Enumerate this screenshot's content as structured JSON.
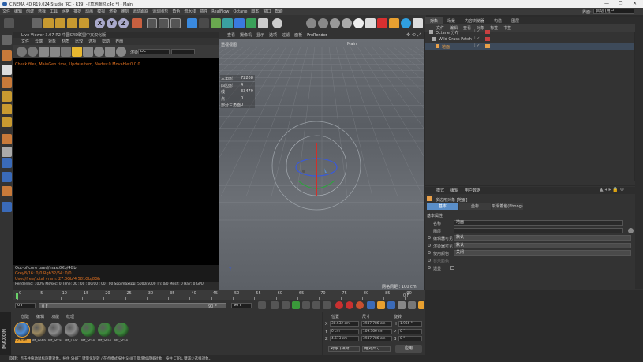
{
  "app": {
    "title": "CINEMA 4D R19.024 Studio (RC - R19) - [草地面积.c4d *] - Main",
    "layout_label": "界面:",
    "layout_value": "启动 (用户)"
  },
  "menu": [
    "文件",
    "编辑",
    "创建",
    "选择",
    "工具",
    "网格",
    "捕捉",
    "动画",
    "模拟",
    "渲染",
    "雕刻",
    "运动跟踪",
    "运动图形",
    "角色",
    "流水线",
    "插件",
    "RealFlow",
    "Octane",
    "脚本",
    "窗口",
    "帮助"
  ],
  "live_viewer": {
    "title": "Live Viewer 3.07-R2 中国C4D联盟中文汉化版",
    "menu": [
      "文件",
      "云端",
      "对象",
      "材质",
      "比较",
      "选项",
      "帮助",
      "界面"
    ],
    "mode_value": "DL",
    "status_line": "Check files, MainGen time, UpdateItem, Nodes:0 Movable:0  0.0",
    "info_lines": [
      "Out-of-core used/max:0Kb/4Gb",
      "Grey8/16: 0/0      Rgb32/64: 0/0",
      "Used/free/total vram: 27.0Gb/4.581Gb/8Gb"
    ],
    "render_status": "Rendering: 100%   Ms/sec: 0   Time: 00 : 00 : 00/00 : 00 : 00   Spp/maxspp: 5000/5000   Tri: 0/0   Mesh: 0   Hair: 0   GPU:"
  },
  "viewport": {
    "menu": [
      "查看",
      "摄像机",
      "显示",
      "选项",
      "过滤",
      "面板",
      "ProRender"
    ],
    "camera_label": "透视视图",
    "camera_name": "Main",
    "stats": [
      {
        "k": "三角形",
        "v": "72208"
      },
      {
        "k": "四边形",
        "v": "4"
      },
      {
        "k": "线",
        "v": "33479"
      },
      {
        "k": "点",
        "v": "0"
      },
      {
        "k": "部分三角面",
        "v": "0"
      }
    ],
    "grid_label": "网格间距 : 100 cm",
    "axis_glyph": "Y"
  },
  "objects": {
    "tabs": [
      "对象",
      "场景",
      "内容浏览器",
      "构造",
      "图层"
    ],
    "menu": [
      "文件",
      "编辑",
      "查看",
      "对象",
      "标签",
      "书签"
    ],
    "items": [
      {
        "name": "Octane 分布",
        "color": "#aaaaaa"
      },
      {
        "name": "Wild Grass Patch",
        "color": "#aaaaaa"
      },
      {
        "name": "地面",
        "color": "#e8a04a"
      }
    ]
  },
  "attributes": {
    "menu": [
      "模式",
      "编辑",
      "用户数据"
    ],
    "title": "多边形对象 [地面]",
    "tabs": [
      "基本",
      "坐标",
      "平滑着色(Phong)"
    ],
    "section": "基本属性",
    "fields": [
      {
        "label": "名称",
        "value": "地面"
      },
      {
        "label": "图层",
        "value": ""
      },
      {
        "label": "编辑器可见",
        "value": "默认"
      },
      {
        "label": "渲染器可见",
        "value": "默认"
      },
      {
        "label": "使用颜色",
        "value": "关闭"
      },
      {
        "label": "显示颜色",
        "value": ""
      },
      {
        "label": "透显",
        "value": ""
      }
    ]
  },
  "timeline": {
    "ticks": [
      "0",
      "5",
      "10",
      "15",
      "20",
      "25",
      "30",
      "35",
      "40",
      "45",
      "50",
      "55",
      "60",
      "65",
      "70",
      "75",
      "80",
      "85",
      "90"
    ],
    "end_label": "0 F",
    "start_field": "0 F",
    "range_start": "0 F",
    "range_end": "90 F",
    "max_field": "90 F"
  },
  "materials": {
    "menu": [
      "创建",
      "编辑",
      "功能",
      "纹理"
    ],
    "items": [
      {
        "name": "OctDiff",
        "color": "#4a8cd8"
      },
      {
        "name": "Mt_Pebb",
        "color": "#9a8860"
      },
      {
        "name": "Mt_Strai",
        "color": "#8a8a8a"
      },
      {
        "name": "Mt_Leaf",
        "color": "#8a8a8a"
      },
      {
        "name": "Mt_Stan",
        "color": "#3a8a3a"
      },
      {
        "name": "Mt_Stan",
        "color": "#3a8a3a"
      },
      {
        "name": "Mt_Stan",
        "color": "#3a8a3a"
      }
    ]
  },
  "coords": {
    "headers": [
      "位置",
      "尺寸",
      "旋转"
    ],
    "rows": [
      {
        "axis": "X",
        "pos": "38.632 cm",
        "size": "3947.786 cm",
        "rot_axis": "H",
        "rot": "1.966 °"
      },
      {
        "axis": "Y",
        "pos": "0 cm",
        "size": "109.366 cm",
        "rot_axis": "P",
        "rot": "0 °"
      },
      {
        "axis": "Z",
        "pos": "4.673 cm",
        "size": "3947.786 cm",
        "rot_axis": "B",
        "rot": "0 °"
      }
    ],
    "mode_value": "对象 (相对)",
    "size_mode": "绝对尺寸",
    "apply_label": "应用"
  },
  "status_bar": "旋转：点击并拖动鼠标旋转对象。按住 SHIFT 键量化旋转 / 在点模式按住 SHIFT 键增加选择对象；按住 CTRL 键减少选择对象。",
  "colors": {
    "accent": "#5a8ec8",
    "gizmo_red": "#d0302a",
    "gizmo_blue": "#3a5ad8",
    "gizmo_green": "#30a040",
    "object_orange": "#e8a04a"
  }
}
